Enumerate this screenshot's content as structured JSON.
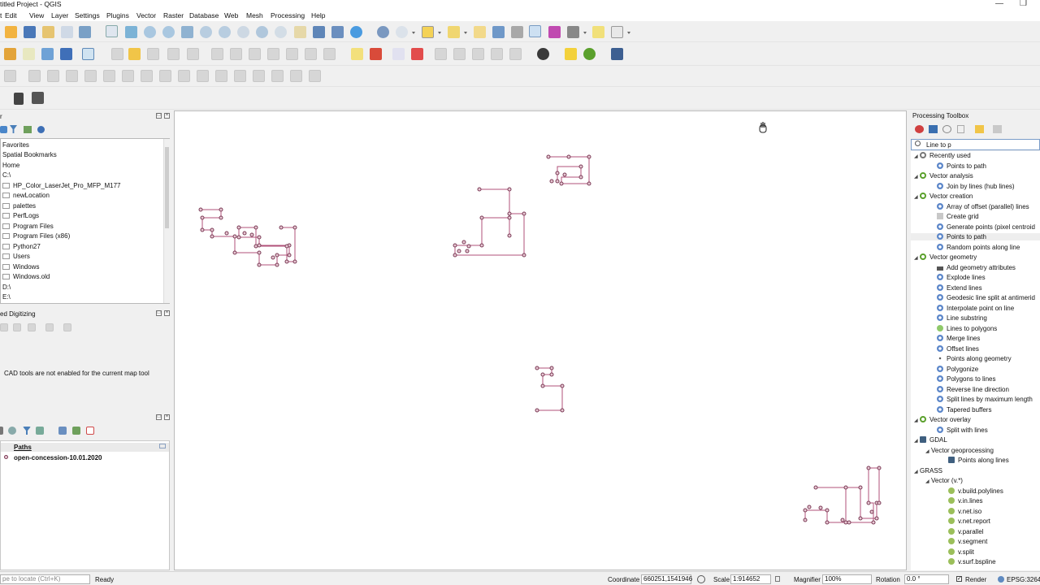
{
  "window": {
    "title": "titled Project - QGIS",
    "minimize": "—",
    "restore": "❐"
  },
  "menu": [
    "t",
    "Edit",
    "View",
    "Layer",
    "Settings",
    "Plugins",
    "Vector",
    "Raster",
    "Database",
    "Web",
    "Mesh",
    "Processing",
    "Help"
  ],
  "browser": {
    "title": "r",
    "items": [
      "Favorites",
      "Spatial Bookmarks",
      "Home",
      "C:\\",
      "HP_Color_LaserJet_Pro_MFP_M177",
      "newLocation",
      "palettes",
      "PerfLogs",
      "Program Files",
      "Program Files (x86)",
      "Python27",
      "Users",
      "Windows",
      "Windows.old",
      "D:\\",
      "E:\\"
    ]
  },
  "advanced_digitizing": {
    "title": "ed Digitizing",
    "message": "CAD tools are not enabled for the current map tool"
  },
  "layers": {
    "group": "Paths",
    "layer": "open-concession-10.01.2020"
  },
  "toolbox": {
    "title": "Processing Toolbox",
    "search_value": "Line to p",
    "tree": [
      {
        "level": 0,
        "icon": "clock",
        "label": "Recently used"
      },
      {
        "level": 1,
        "icon": "gear",
        "label": "Points to path"
      },
      {
        "level": 0,
        "icon": "qgis",
        "label": "Vector analysis"
      },
      {
        "level": 1,
        "icon": "gear",
        "label": "Join by lines (hub lines)"
      },
      {
        "level": 0,
        "icon": "qgis",
        "label": "Vector creation"
      },
      {
        "level": 1,
        "icon": "gear",
        "label": "Array of offset (parallel) lines"
      },
      {
        "level": 1,
        "icon": "grid",
        "label": "Create grid"
      },
      {
        "level": 1,
        "icon": "gear",
        "label": "Generate points (pixel centroid"
      },
      {
        "level": 1,
        "icon": "gear",
        "label": "Points to path",
        "highlight": true
      },
      {
        "level": 1,
        "icon": "gear",
        "label": "Random points along line"
      },
      {
        "level": 0,
        "icon": "qgis",
        "label": "Vector geometry"
      },
      {
        "level": 1,
        "icon": "table",
        "label": "Add geometry attributes"
      },
      {
        "level": 1,
        "icon": "gear",
        "label": "Explode lines"
      },
      {
        "level": 1,
        "icon": "gear",
        "label": "Extend lines"
      },
      {
        "level": 1,
        "icon": "gear",
        "label": "Geodesic line split at antimerid"
      },
      {
        "level": 1,
        "icon": "gear",
        "label": "Interpolate point on line"
      },
      {
        "level": 1,
        "icon": "gear",
        "label": "Line substring"
      },
      {
        "level": 1,
        "icon": "pen",
        "label": "Lines to polygons"
      },
      {
        "level": 1,
        "icon": "gear",
        "label": "Merge lines"
      },
      {
        "level": 1,
        "icon": "gear",
        "label": "Offset lines"
      },
      {
        "level": 1,
        "icon": "dots",
        "label": "Points along geometry"
      },
      {
        "level": 1,
        "icon": "gear",
        "label": "Polygonize"
      },
      {
        "level": 1,
        "icon": "gear",
        "label": "Polygons to lines"
      },
      {
        "level": 1,
        "icon": "gear",
        "label": "Reverse line direction"
      },
      {
        "level": 1,
        "icon": "gear",
        "label": "Split lines by maximum length"
      },
      {
        "level": 1,
        "icon": "gear",
        "label": "Tapered buffers"
      },
      {
        "level": 0,
        "icon": "qgis",
        "label": "Vector overlay"
      },
      {
        "level": 1,
        "icon": "gear",
        "label": "Split with lines"
      },
      {
        "level": 0,
        "icon": "gdal",
        "label": "GDAL"
      },
      {
        "level": 1,
        "icon": "none",
        "label": "Vector geoprocessing"
      },
      {
        "level": 2,
        "icon": "gdal",
        "label": "Points along lines"
      },
      {
        "level": 0,
        "icon": "none",
        "label": "GRASS"
      },
      {
        "level": 1,
        "icon": "none",
        "label": "Vector (v.*)"
      },
      {
        "level": 2,
        "icon": "gnu",
        "label": "v.build.polylines"
      },
      {
        "level": 2,
        "icon": "gnu",
        "label": "v.in.lines"
      },
      {
        "level": 2,
        "icon": "gnu",
        "label": "v.net.iso"
      },
      {
        "level": 2,
        "icon": "gnu",
        "label": "v.net.report"
      },
      {
        "level": 2,
        "icon": "gnu",
        "label": "v.parallel"
      },
      {
        "level": 2,
        "icon": "gnu",
        "label": "v.segment"
      },
      {
        "level": 2,
        "icon": "gnu",
        "label": "v.split"
      },
      {
        "level": 2,
        "icon": "gnu",
        "label": "v.surf.bspline"
      }
    ]
  },
  "statusbar": {
    "locate_placeholder": "pe to locate (Ctrl+K)",
    "ready": "Ready",
    "coordinate_label": "Coordinate",
    "coordinate_value": "660251,1541946",
    "scale_label": "Scale",
    "scale_value": "1:914652",
    "magnifier_label": "Magnifier",
    "magnifier_value": "100%",
    "rotation_label": "Rotation",
    "rotation_value": "0.0 °",
    "render_label": "Render",
    "crs": "EPSG:32648"
  },
  "colors": {
    "path_stroke": "#b05078",
    "node_fill": "#e8c9d4",
    "node_stroke": "#7a3a55",
    "accent": "#5aa02c"
  }
}
